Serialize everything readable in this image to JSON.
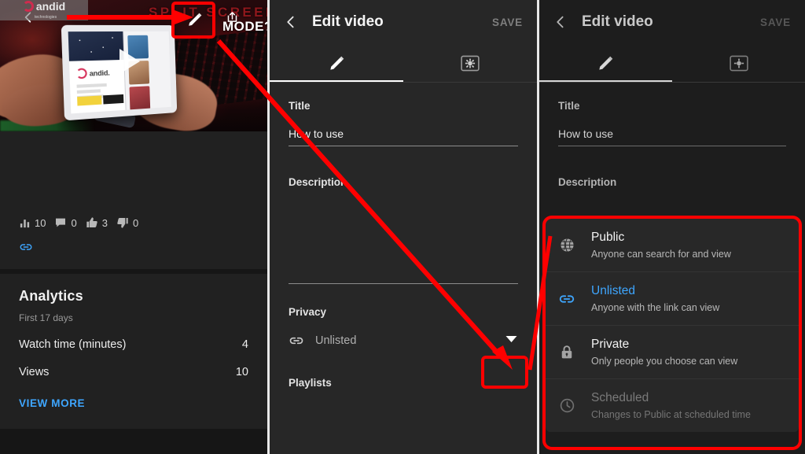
{
  "thumbnail": {
    "overlay_text_line1": "SPLIT SCREEN",
    "overlay_text_line2": "MODE?",
    "watermark_brand": "andid",
    "watermark_sub": "technologies",
    "tablet_brand": "andid.",
    "icons": {
      "back": "back-chevron-icon",
      "edit": "pencil-icon",
      "share": "share-icon",
      "play": "play-icon"
    }
  },
  "stats": {
    "views_count": "10",
    "comments_count": "0",
    "likes_count": "3",
    "dislikes_count": "0",
    "link_icon": "link-icon"
  },
  "analytics": {
    "title": "Analytics",
    "subtitle": "First 17 days",
    "rows": [
      {
        "label": "Watch time (minutes)",
        "value": "4"
      },
      {
        "label": "Views",
        "value": "10"
      }
    ],
    "view_more": "VIEW MORE",
    "accent_color": "#3ea6ff"
  },
  "edit_video": {
    "header": {
      "back_icon": "back-chevron-icon",
      "title": "Edit video",
      "save_label": "SAVE"
    },
    "tabs": [
      {
        "icon": "pencil-icon",
        "active": true
      },
      {
        "icon": "monetization-gear-icon",
        "active": false
      }
    ],
    "title_field": {
      "label": "Title",
      "value": "How to use"
    },
    "description_field": {
      "label": "Description",
      "value": ""
    },
    "privacy": {
      "label": "Privacy",
      "value": "Unlisted",
      "icon": "link-icon",
      "caret": "chevron-down-icon"
    },
    "playlists": {
      "label": "Playlists"
    }
  },
  "privacy_sheet": {
    "options": [
      {
        "icon": "globe-icon",
        "title": "Public",
        "desc": "Anyone can search for and view",
        "state": "normal"
      },
      {
        "icon": "link-icon",
        "title": "Unlisted",
        "desc": "Anyone with the link can view",
        "state": "selected"
      },
      {
        "icon": "lock-icon",
        "title": "Private",
        "desc": "Only people you choose can view",
        "state": "normal"
      },
      {
        "icon": "clock-icon",
        "title": "Scheduled",
        "desc": "Changes to Public at scheduled time",
        "state": "disabled"
      }
    ],
    "selected_color": "#3ea6ff"
  },
  "annotation": {
    "highlight_color": "#ff0000"
  }
}
